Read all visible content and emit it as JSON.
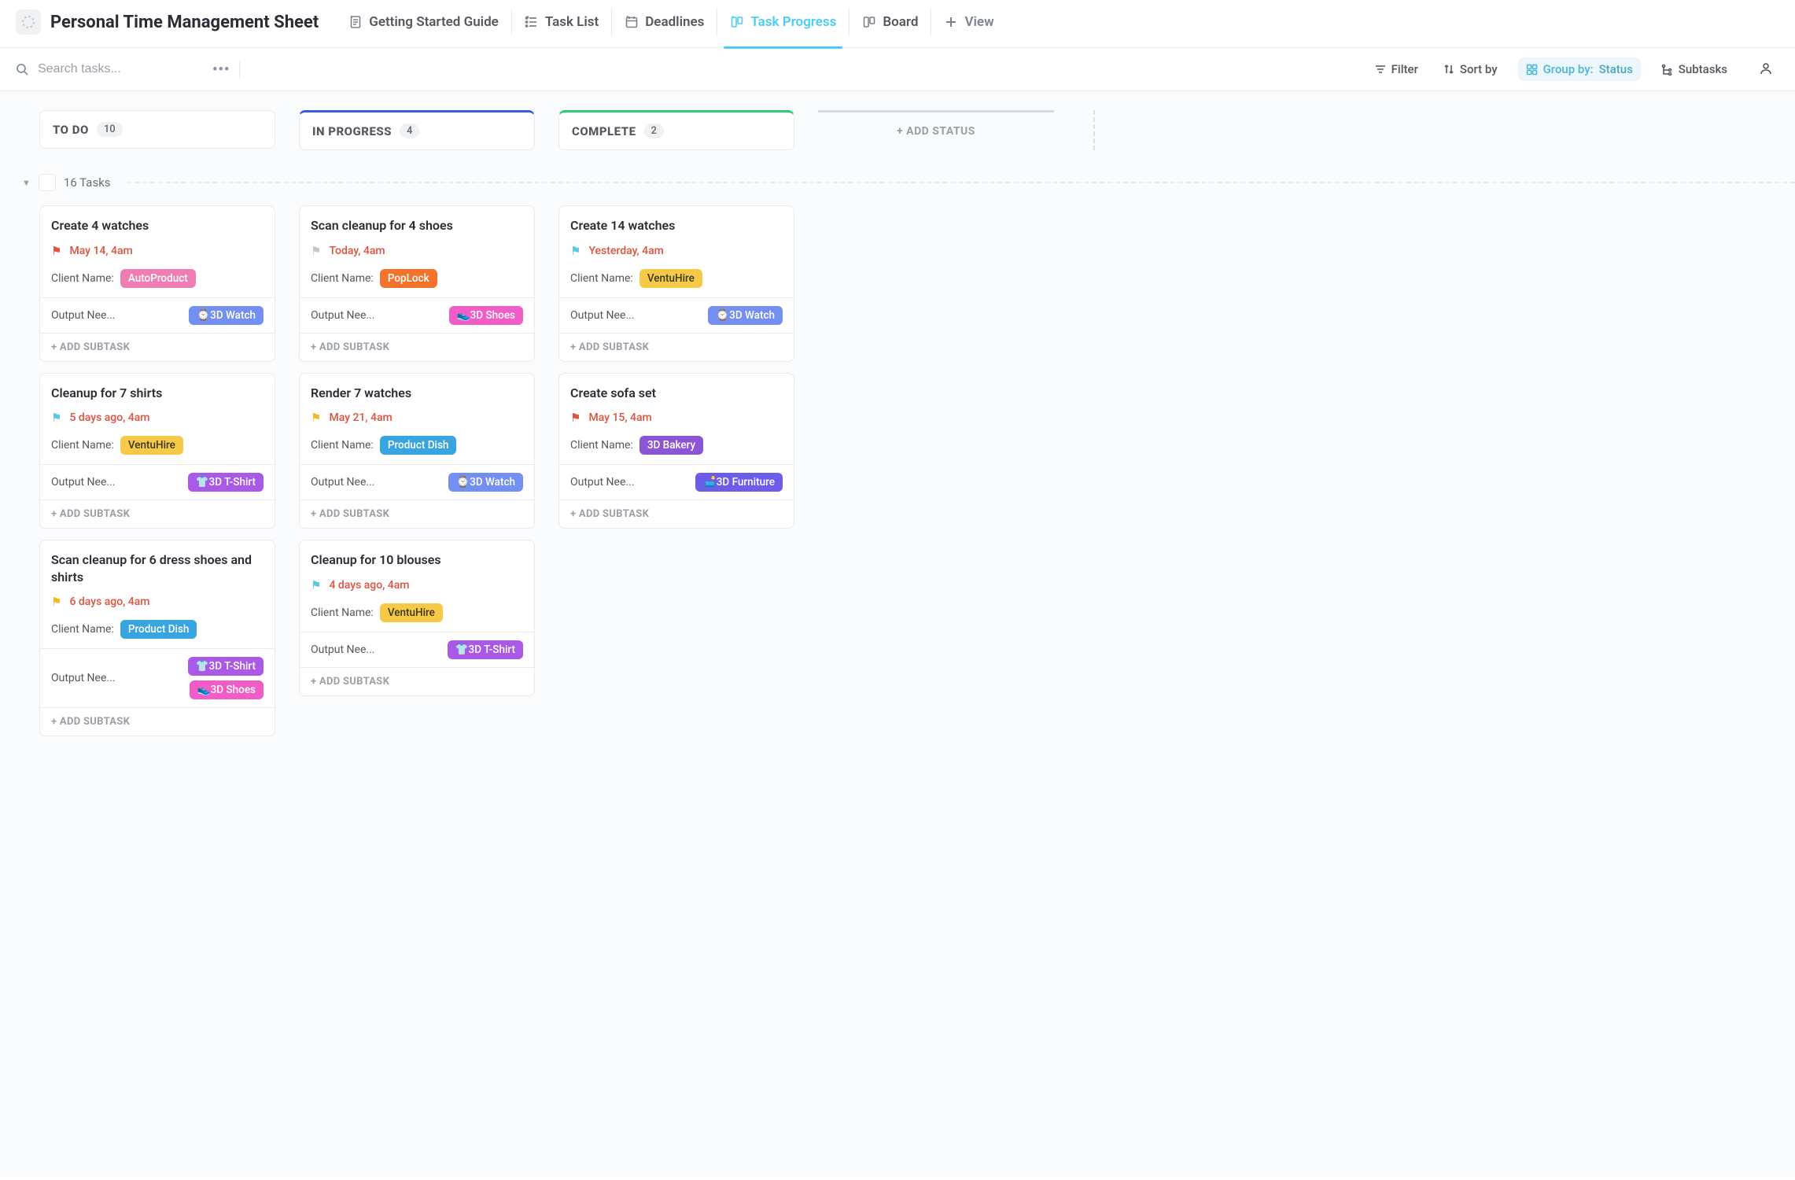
{
  "header": {
    "title": "Personal Time Management Sheet",
    "tabs": [
      {
        "label": "Getting Started Guide"
      },
      {
        "label": "Task List"
      },
      {
        "label": "Deadlines"
      },
      {
        "label": "Task Progress"
      },
      {
        "label": "Board"
      }
    ],
    "add_view": "View"
  },
  "toolbar": {
    "search_placeholder": "Search tasks...",
    "filter": "Filter",
    "sort": "Sort by",
    "group_label": "Group by:",
    "group_value": "Status",
    "subtasks": "Subtasks"
  },
  "columns": {
    "todo": {
      "name": "TO DO",
      "count": "10"
    },
    "inprog": {
      "name": "IN PROGRESS",
      "count": "4"
    },
    "complete": {
      "name": "COMPLETE",
      "count": "2"
    },
    "add_status": "+ ADD STATUS"
  },
  "group": {
    "label": "16 Tasks"
  },
  "labels": {
    "client_name": "Client Name:",
    "output_needed": "Output Nee...",
    "add_subtask": "+ ADD SUBTASK"
  },
  "chips": {
    "autoproduct": "AutoProduct",
    "poplock": "PopLock",
    "ventuhire": "VentuHire",
    "productdish": "Product Dish",
    "bakery3d": "3D Bakery",
    "watch3d": "⌚3D Watch",
    "shoes3d": "👟3D Shoes",
    "tshirt3d": "👕3D T-Shirt",
    "furniture3d": "🛋️3D Furniture"
  },
  "cards": {
    "todo": [
      {
        "title": "Create 4 watches",
        "due": "May 14, 4am",
        "flag": "red",
        "client": "autoproduct",
        "outputs": [
          "watch3d"
        ]
      },
      {
        "title": "Cleanup for 7 shirts",
        "due": "5 days ago, 4am",
        "flag": "teal",
        "client": "ventuhire",
        "outputs": [
          "tshirt3d"
        ]
      },
      {
        "title": "Scan cleanup for 6 dress shoes and shirts",
        "due": "6 days ago, 4am",
        "flag": "yellow",
        "client": "productdish",
        "outputs": [
          "tshirt3d",
          "shoes3d"
        ]
      }
    ],
    "inprog": [
      {
        "title": "Scan cleanup for 4 shoes",
        "due": "Today, 4am",
        "flag": "grey",
        "client": "poplock",
        "outputs": [
          "shoes3d"
        ]
      },
      {
        "title": "Render 7 watches",
        "due": "May 21, 4am",
        "flag": "yellow",
        "client": "productdish",
        "outputs": [
          "watch3d"
        ]
      },
      {
        "title": "Cleanup for 10 blouses",
        "due": "4 days ago, 4am",
        "flag": "teal",
        "client": "ventuhire",
        "outputs": [
          "tshirt3d"
        ]
      }
    ],
    "complete": [
      {
        "title": "Create 14 watches",
        "due": "Yesterday, 4am",
        "flag": "teal",
        "client": "ventuhire",
        "outputs": [
          "watch3d"
        ]
      },
      {
        "title": "Create sofa set",
        "due": "May 15, 4am",
        "flag": "red",
        "client": "bakery3d",
        "outputs": [
          "furniture3d"
        ]
      }
    ]
  }
}
